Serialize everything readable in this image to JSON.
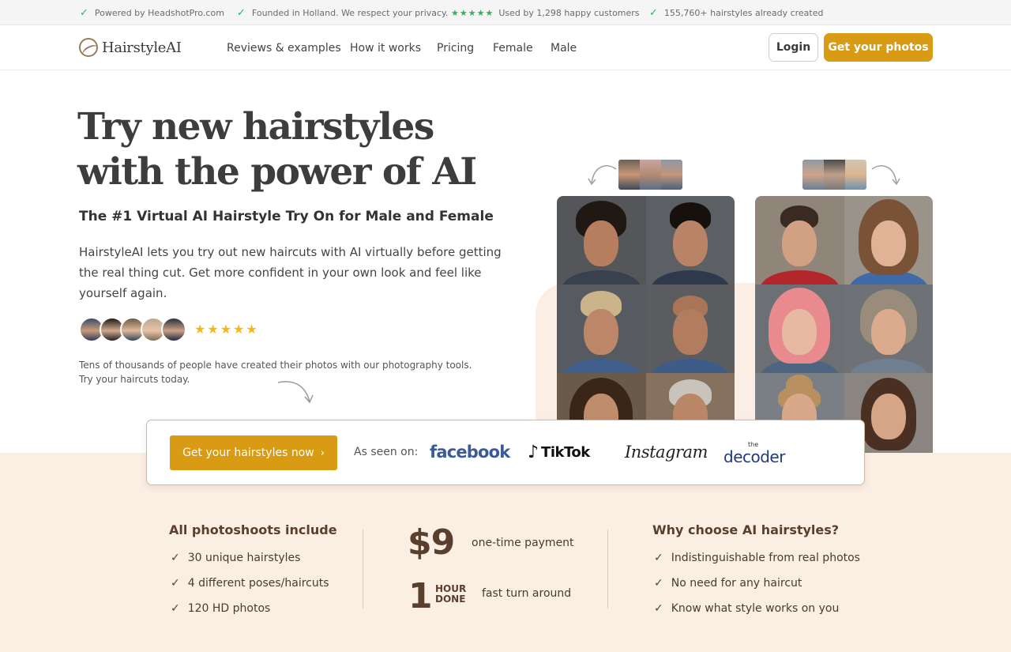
{
  "topbar": {
    "items": [
      "Powered by HeadshotPro.com",
      "Founded in Holland. We respect your privacy.",
      "Used by 1,298 happy customers",
      "155,760+ hairstyles already created"
    ],
    "rating_stars": "★★★★★"
  },
  "nav": {
    "logo": "HairstyleAI",
    "links": [
      "Reviews & examples",
      "How it works",
      "Pricing",
      "Female",
      "Male"
    ],
    "login": "Login",
    "cta": "Get your photos"
  },
  "hero": {
    "title_line1": "Try new hairstyles",
    "title_line2": "with the power of AI",
    "subtitle": "The #1 Virtual AI Hairstyle Try On for Male and Female",
    "description": "HairstyleAI lets you try out new haircuts with AI virtually before getting the real thing cut. Get more confident in your own look and feel like yourself again.",
    "stars": "★★★★★",
    "proof_line1": "Tens of thousands of people have created their photos with our photography tools.",
    "proof_line2": "Try your haircuts today."
  },
  "card": {
    "cta": "Get your hairstyles now",
    "cta_icon": "chevron-right-icon",
    "seen_on": "As seen on:",
    "logos": {
      "facebook": "facebook",
      "tiktok": "TikTok",
      "instagram": "Instagram",
      "decoder_small": "the",
      "decoder": "decoder"
    }
  },
  "features": {
    "left_title": "All photoshoots include",
    "left_items": [
      "30 unique hairstyles",
      "4 different poses/haircuts",
      "120 HD photos"
    ],
    "price": "$9",
    "price_note": "one-time payment",
    "turnaround_num": "1",
    "turnaround_unit_1": "HOUR",
    "turnaround_unit_2": "DONE",
    "turnaround_note": "fast turn around",
    "right_title": "Why choose AI hairstyles?",
    "right_items": [
      "Indistinguishable from real photos",
      "No need for any haircut",
      "Know what style works on you"
    ]
  },
  "colors": {
    "accent": "#d99b14",
    "band": "#fbeee2",
    "brown_text": "#5a3f2e",
    "check_green": "#2fb35a",
    "star_yellow": "#f4b81a"
  }
}
